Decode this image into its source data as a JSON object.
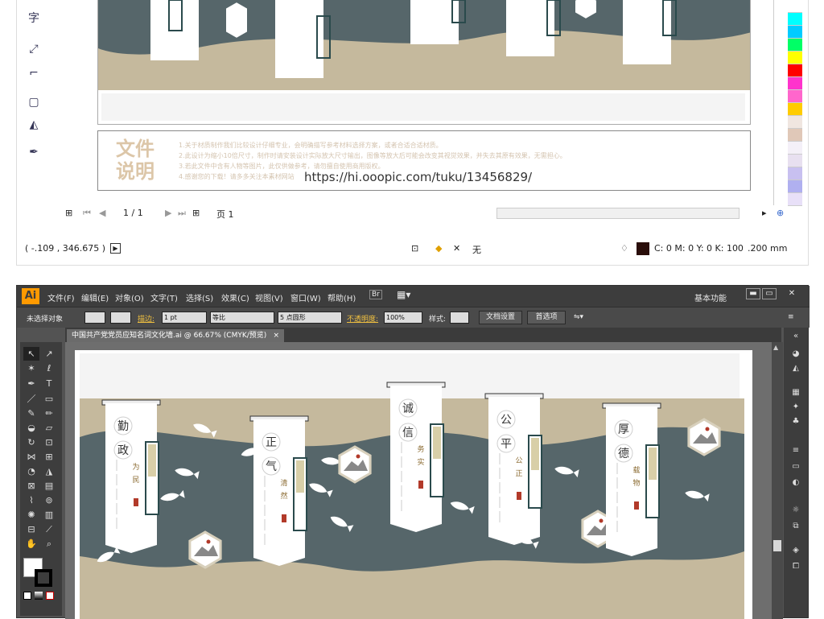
{
  "top_window": {
    "doc_info": {
      "heading_line1": "文件",
      "heading_line2": "说明",
      "fine_lines": [
        "1.关于材质制作我们比较设计仔细专业，会明确描写参考材料选择方案，或者合适合适材质。",
        "2.此设计为缩小10倍尺寸，制作时请安装设计实际放大尺寸输出，图像等放大后可能会改变其视觉效果，并失去其原有效果，无需担心。",
        "3.若此文件中含有人物等图片，此仅供做参考，请勿擅自使用商用版权。",
        "4.感谢您的下载！请多多关注本素材网站"
      ],
      "url": "https://hi.ooopic.com/tuku/13456829/"
    },
    "pager": {
      "page_label": "1 / 1",
      "page_name": "页 1"
    },
    "status": {
      "coords": "( -.109 , 346.675 )",
      "fill_none": "无",
      "color_readout": "C: 0 M: 0 Y: 0 K: 100",
      "stroke_width": ".200 mm"
    },
    "palette_colors": [
      "#ffffff",
      "#00ffff",
      "#00ccff",
      "#00ff66",
      "#ffff00",
      "#ff0000",
      "#ff33cc",
      "#ff66cc",
      "#ffcc00",
      "#f0e6e0",
      "#e0c8b8",
      "#f4f0f8",
      "#e8e0f0",
      "#c8c0f0",
      "#b0b0f0",
      "#e8e0f8"
    ]
  },
  "ai_window": {
    "logo": "Ai",
    "menu": [
      "文件(F)",
      "编辑(E)",
      "对象(O)",
      "文字(T)",
      "选择(S)",
      "效果(C)",
      "视图(V)",
      "窗口(W)",
      "帮助(H)"
    ],
    "workspace": "基本功能",
    "control_bar": {
      "selection": "未选择对象",
      "stroke_label": "描边:",
      "stroke_value": "1 pt",
      "stroke_style": "等比",
      "brush_value": "5 点圆形",
      "opacity_label": "不透明度:",
      "opacity_value": "100%",
      "style_label": "样式:",
      "doc_setup": "文档设置",
      "prefs": "首选项"
    },
    "tab": {
      "title": "中国共产党党员应知名词文化墙.ai @ 66.67% (CMYK/预览)",
      "close": "×"
    }
  },
  "artwork": {
    "colors": {
      "beige": "#c5b99d",
      "slate": "#56666a",
      "scroll_paper": "#ffffff",
      "frame_dark": "#2a4a4c",
      "red_seal": "#b23a2a"
    },
    "scrolls": [
      {
        "title_chars": [
          "勤",
          "政"
        ],
        "tag": "为民"
      },
      {
        "title_chars": [
          "正",
          "气"
        ],
        "tag": "清然"
      },
      {
        "title_chars": [
          "诚",
          "信"
        ],
        "tag": "务实"
      },
      {
        "title_chars": [
          "公",
          "平"
        ],
        "tag": "公正"
      },
      {
        "title_chars": [
          "厚",
          "德"
        ],
        "tag": "载物"
      }
    ]
  }
}
